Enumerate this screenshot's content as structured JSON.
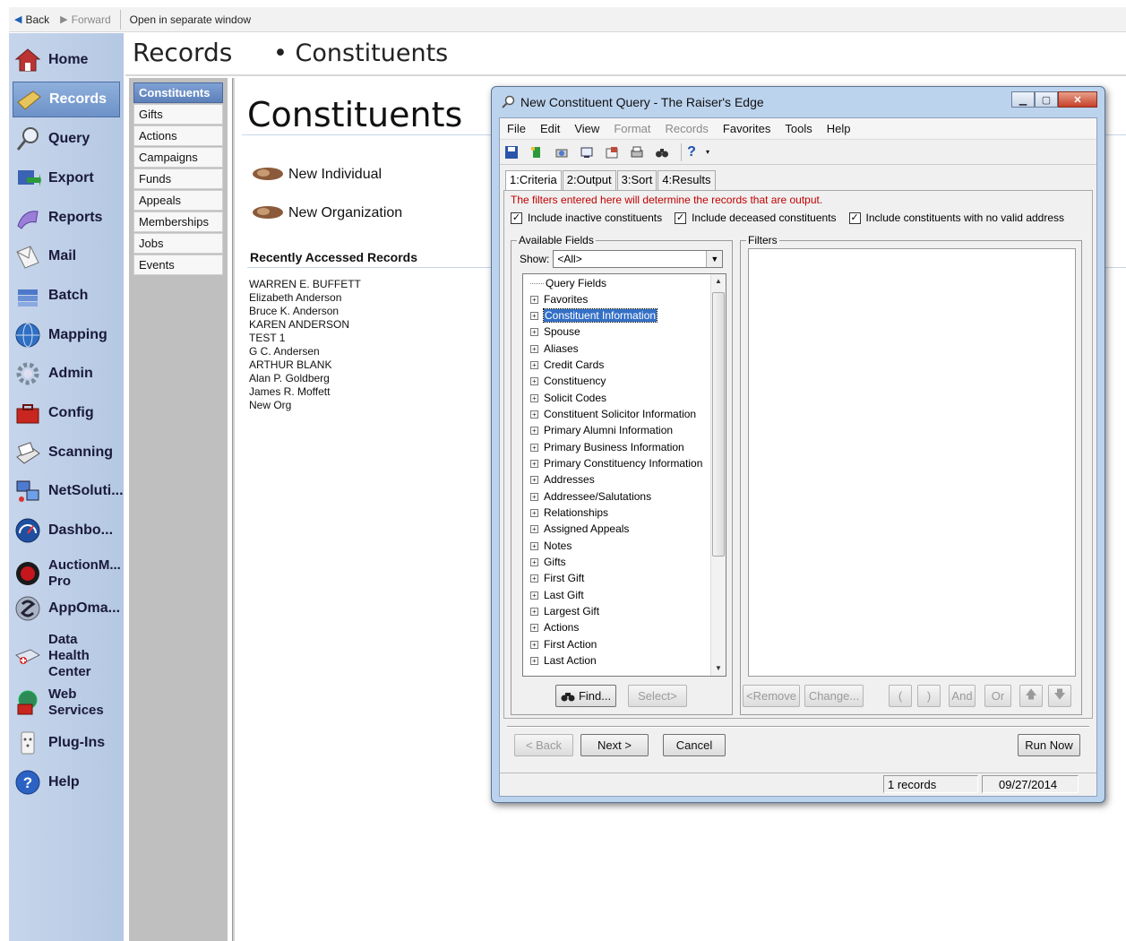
{
  "topbar": {
    "back": "Back",
    "forward": "Forward",
    "open_separate": "Open in separate window"
  },
  "leftnav": {
    "items": [
      {
        "label": "Home"
      },
      {
        "label": "Records"
      },
      {
        "label": "Query"
      },
      {
        "label": "Export"
      },
      {
        "label": "Reports"
      },
      {
        "label": "Mail"
      },
      {
        "label": "Batch"
      },
      {
        "label": "Mapping"
      },
      {
        "label": "Admin"
      },
      {
        "label": "Config"
      },
      {
        "label": "Scanning"
      },
      {
        "label": "NetSoluti..."
      },
      {
        "label": "Dashbo..."
      },
      {
        "label": "AuctionM...",
        "label2": "Pro"
      },
      {
        "label": "AppOma..."
      },
      {
        "label": "Data",
        "label2": "Health",
        "label3": "Center"
      },
      {
        "label": "Web",
        "label2": "Services"
      },
      {
        "label": "Plug-Ins"
      },
      {
        "label": "Help"
      }
    ]
  },
  "header": {
    "section": "Records",
    "crumb": "Constituents",
    "bullet": "•"
  },
  "subnav": {
    "items": [
      "Constituents",
      "Gifts",
      "Actions",
      "Campaigns",
      "Funds",
      "Appeals",
      "Memberships",
      "Jobs",
      "Events"
    ]
  },
  "content": {
    "title": "Constituents",
    "new_individual": "New Individual",
    "new_organization": "New Organization",
    "recent_heading": "Recently Accessed Records",
    "recent": [
      "WARREN E. BUFFETT",
      "Elizabeth Anderson",
      "Bruce K. Anderson",
      "KAREN ANDERSON",
      "TEST 1",
      "G C. Andersen",
      "ARTHUR BLANK",
      "Alan P. Goldberg",
      "James R. Moffett",
      "New Org"
    ]
  },
  "dialog": {
    "title": "New Constituent Query - The Raiser's Edge",
    "menu": [
      {
        "label": "File",
        "enabled": true
      },
      {
        "label": "Edit",
        "enabled": true
      },
      {
        "label": "View",
        "enabled": true
      },
      {
        "label": "Format",
        "enabled": false
      },
      {
        "label": "Records",
        "enabled": false
      },
      {
        "label": "Favorites",
        "enabled": true
      },
      {
        "label": "Tools",
        "enabled": true
      },
      {
        "label": "Help",
        "enabled": true
      }
    ],
    "tabs": [
      "1:Criteria",
      "2:Output",
      "3:Sort",
      "4:Results"
    ],
    "info": "The filters entered here will determine the records that are output.",
    "checks": [
      {
        "label": "Include inactive constituents",
        "checked": true
      },
      {
        "label": "Include deceased constituents",
        "checked": true
      },
      {
        "label": "Include constituents with no valid address",
        "checked": true
      }
    ],
    "available_fields_label": "Available Fields",
    "filters_label": "Filters",
    "show_label": "Show:",
    "show_value": "<All>",
    "tree": [
      {
        "label": "Query Fields",
        "expand": false
      },
      {
        "label": "Favorites",
        "expand": true
      },
      {
        "label": "Constituent Information",
        "expand": true,
        "selected": true
      },
      {
        "label": "Spouse",
        "expand": true
      },
      {
        "label": "Aliases",
        "expand": true
      },
      {
        "label": "Credit Cards",
        "expand": true
      },
      {
        "label": "Constituency",
        "expand": true
      },
      {
        "label": "Solicit Codes",
        "expand": true
      },
      {
        "label": "Constituent Solicitor Information",
        "expand": true
      },
      {
        "label": "Primary Alumni Information",
        "expand": true
      },
      {
        "label": "Primary Business Information",
        "expand": true
      },
      {
        "label": "Primary Constituency Information",
        "expand": true
      },
      {
        "label": "Addresses",
        "expand": true
      },
      {
        "label": "Addressee/Salutations",
        "expand": true
      },
      {
        "label": "Relationships",
        "expand": true
      },
      {
        "label": "Assigned Appeals",
        "expand": true
      },
      {
        "label": "Notes",
        "expand": true
      },
      {
        "label": "Gifts",
        "expand": true
      },
      {
        "label": "First Gift",
        "expand": true
      },
      {
        "label": "Last Gift",
        "expand": true
      },
      {
        "label": "Largest Gift",
        "expand": true
      },
      {
        "label": "Actions",
        "expand": true
      },
      {
        "label": "First Action",
        "expand": true
      },
      {
        "label": "Last Action",
        "expand": true
      }
    ],
    "buttons": {
      "find": "Find...",
      "select": "Select>",
      "remove": "<Remove",
      "change": "Change...",
      "lparen": "(",
      "rparen": ")",
      "and": "And",
      "or": "Or",
      "back": "< Back",
      "next": "Next >",
      "cancel": "Cancel",
      "run_now": "Run Now"
    },
    "status": {
      "records": "1 records",
      "date": "09/27/2014"
    }
  },
  "colors": {
    "nav_bg": "#c6d5eb",
    "active_nav": "#6d92c8",
    "selection": "#3470c6",
    "info_red": "#c00000"
  }
}
